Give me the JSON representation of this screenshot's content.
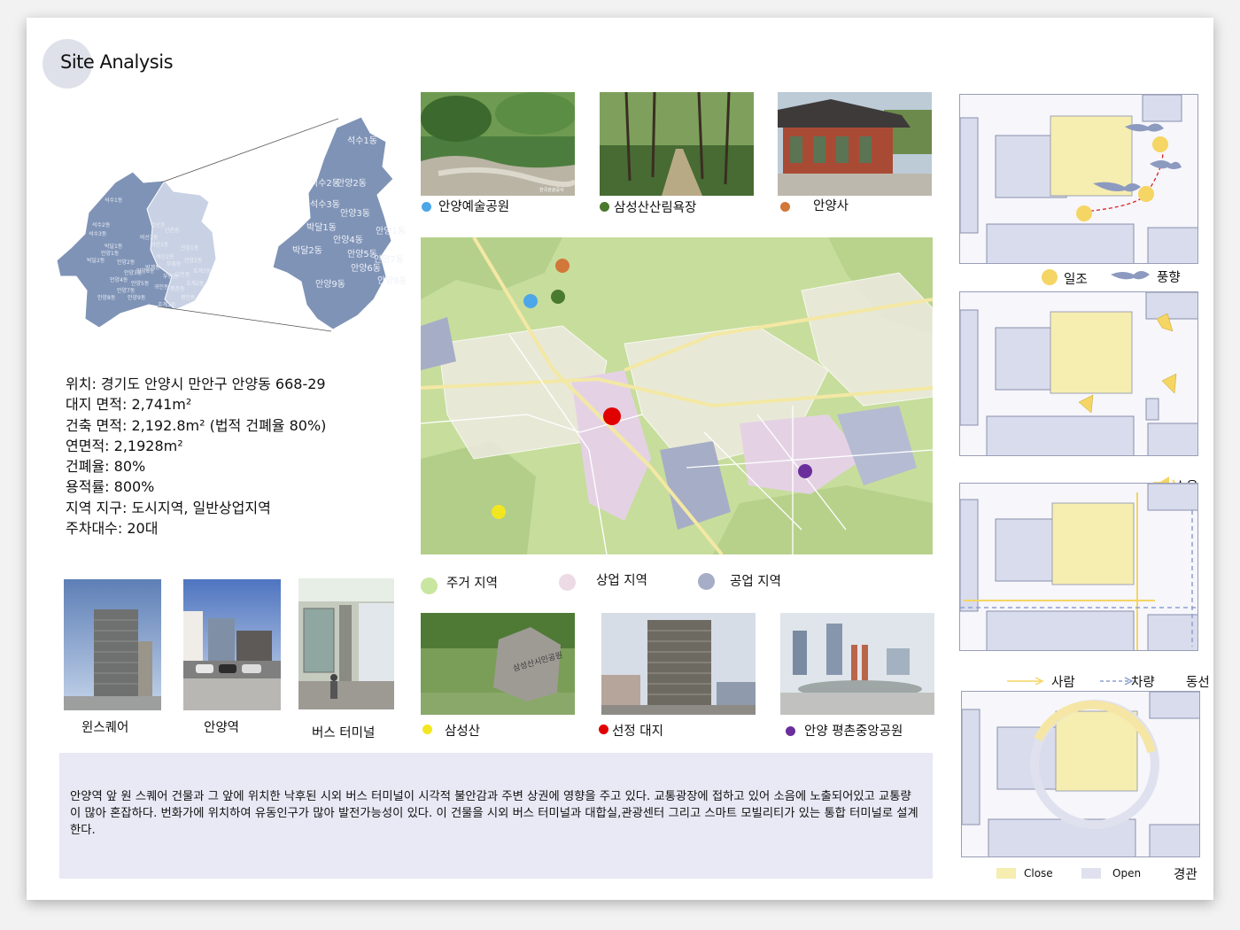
{
  "header": {
    "title": "Site Analysis"
  },
  "district_map": {
    "left_labels": [
      "석수1동",
      "석수2동",
      "석수3동",
      "박달1동",
      "박달2동",
      "안양1동",
      "안양2동",
      "안양3동",
      "안양4동",
      "안양5동",
      "안양6동",
      "안양7동",
      "안양8동",
      "안양9동",
      "비산1동",
      "비산2동",
      "비산3동",
      "부흥동",
      "달안동",
      "관양1동",
      "관양2동",
      "부림동",
      "평촌동",
      "평안동",
      "귀인동",
      "호계1동",
      "호계2동",
      "호계3동",
      "범계동",
      "신촌동",
      "갈산동"
    ],
    "zoom_labels": [
      "석수1동",
      "석수2동",
      "안양2동",
      "석수3동",
      "안양3동",
      "박달1동",
      "안양1동",
      "박달2동",
      "안양4동",
      "안양5동",
      "안양7동",
      "안양6동",
      "안양9동",
      "안양8동"
    ]
  },
  "site_info": {
    "lines": [
      "위치: 경기도 안양시 만안구 안양동 668-29",
      "대지 면적: 2,741m²",
      "건축 면적: 2,192.8m² (법적 건폐율 80%)",
      "연면적: 2,1928m²",
      "건폐율: 80%",
      "용적률: 800%",
      "지역 지구: 도시지역, 일반상업지역",
      "주차대수: 20대"
    ]
  },
  "photos_top": [
    {
      "caption": "안양예술공원",
      "dot_color": "#4da6e8"
    },
    {
      "caption": "삼성산산림욕장",
      "dot_color": "#4a7a2e"
    },
    {
      "caption": "안양사",
      "dot_color": "#d2773a"
    }
  ],
  "zone_legend": [
    {
      "label": "주거 지역",
      "color": "#c8e6a0"
    },
    {
      "label": "상업 지역",
      "color": "#ecdbe4"
    },
    {
      "label": "공업 지역",
      "color": "#a6adc6"
    }
  ],
  "photos_bottom": [
    {
      "caption": "삼성산",
      "dot_color": "#f2e620"
    },
    {
      "caption": "선정  대지",
      "dot_color": "#e00000"
    },
    {
      "caption": "안양 평촌중앙공원",
      "dot_color": "#6a2e9c"
    }
  ],
  "photos_left": [
    {
      "caption": "윈스퀘어"
    },
    {
      "caption": "안양역"
    },
    {
      "caption": "버스 터미널"
    }
  ],
  "photo_watermark": "한국관광공사",
  "park_stone_text": "삼성산시민공원",
  "description": "  안양역 앞 원 스퀘어 건물과 그 앞에 위치한 낙후된 시외 버스 터미널이 시각적 불안감과 주변 상권에 영향을 주고 있다. 교통광장에 접하고 있어 소음에 노출되어있고 교통량이 많아 혼잡하다. 번화가에 위치하여 유동인구가 많아 발전가능성이 있다. 이 건물을 시외 버스 터미널과 대합실,관광센터 그리고 스마트 모빌리티가 있는 통합 터미널로 설계한다.",
  "analysis": {
    "sun_label": "일조",
    "wind_label": "풍향",
    "noise_label": "소음",
    "people_label": "사람",
    "vehicle_label": "차량",
    "circulation_label": "동선",
    "close_label": "Close",
    "open_label": "Open",
    "view_label": "경관"
  },
  "colors": {
    "site_block": "#f6edb0",
    "block_fill": "#d8dcec",
    "block_stroke": "#8a90ac",
    "sun": "#f5d563",
    "wind": "#8c9ac0"
  }
}
